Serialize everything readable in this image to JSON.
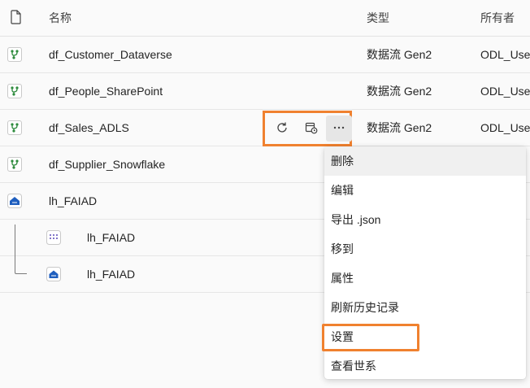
{
  "header": {
    "name": "名称",
    "type": "类型",
    "owner": "所有者"
  },
  "rows": [
    {
      "name": "df_Customer_Dataverse",
      "type": "数据流 Gen2",
      "owner": "ODL_User"
    },
    {
      "name": "df_People_SharePoint",
      "type": "数据流 Gen2",
      "owner": "ODL_User"
    },
    {
      "name": "df_Sales_ADLS",
      "type": "数据流 Gen2",
      "owner": "ODL_User"
    },
    {
      "name": "df_Supplier_Snowflake",
      "type": "",
      "owner": ""
    },
    {
      "name": "lh_FAIAD",
      "type": "",
      "owner": ""
    },
    {
      "name": "lh_FAIAD",
      "type": "",
      "owner": ""
    },
    {
      "name": "lh_FAIAD",
      "type": "",
      "owner": ""
    }
  ],
  "context_menu": {
    "items": [
      "删除",
      "编辑",
      "导出 .json",
      "移到",
      "属性",
      "刷新历史记录",
      "设置",
      "查看世系"
    ]
  },
  "colors": {
    "highlight": "#f0812f",
    "dataflow_icon": "#2e8b3d",
    "lakehouse_icon": "#1f5fbf"
  }
}
